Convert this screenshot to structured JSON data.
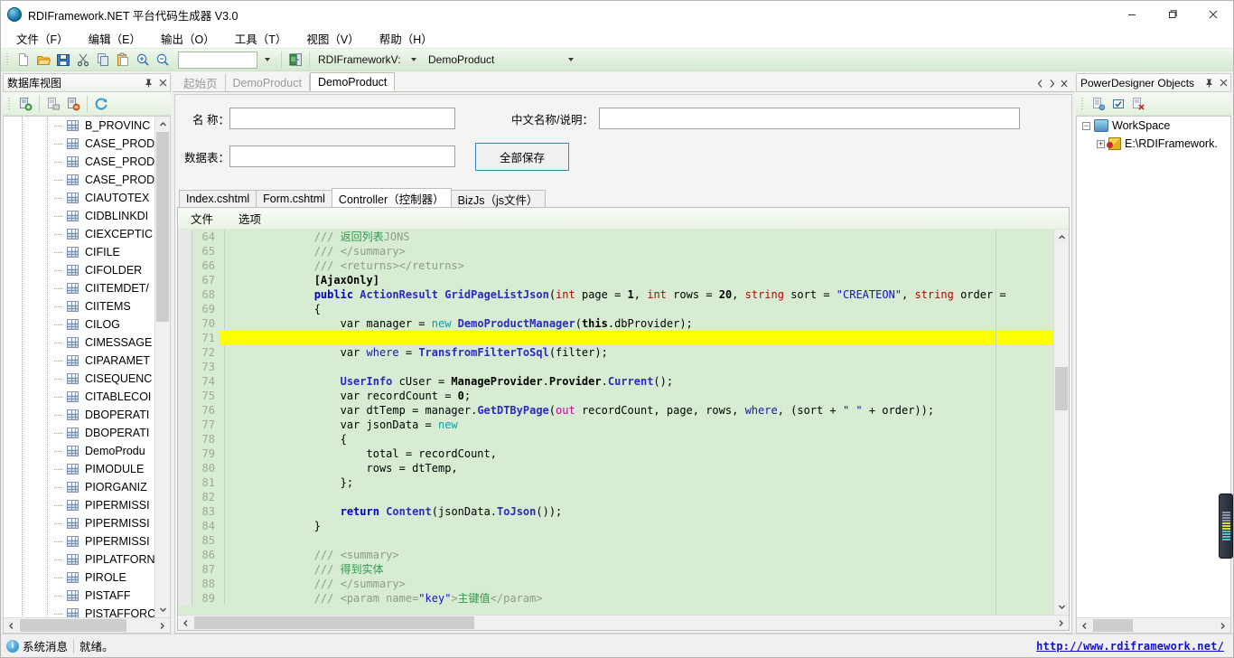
{
  "window": {
    "title": "RDIFramework.NET 平台代码生成器 V3.0",
    "icon": "app-logo-icon",
    "minimize": "minimize-icon",
    "maximize": "maximize-icon",
    "close": "close-icon"
  },
  "menubar": {
    "items": [
      {
        "label": "文件（F）"
      },
      {
        "label": "编辑（E）"
      },
      {
        "label": "输出（O）"
      },
      {
        "label": "工具（T）"
      },
      {
        "label": "视图（V）"
      },
      {
        "label": "帮助（H）"
      }
    ]
  },
  "toolbar": {
    "buttons": [
      {
        "name": "new-file-icon",
        "glyph": "doc"
      },
      {
        "name": "open-folder-icon",
        "glyph": "folder"
      },
      {
        "name": "save-icon",
        "glyph": "save"
      },
      {
        "name": "cut-icon",
        "glyph": "cut"
      },
      {
        "name": "copy-icon",
        "glyph": "copy"
      },
      {
        "name": "paste-icon",
        "glyph": "paste"
      },
      {
        "name": "zoom-in-icon",
        "glyph": "zoomin"
      },
      {
        "name": "zoom-out-icon",
        "glyph": "zoomout"
      }
    ],
    "search_value": "",
    "export_icon": "export-door-icon",
    "project_combo_value": "RDIFrameworkV:",
    "table_combo_value": "DemoProduct"
  },
  "left_panel": {
    "title": "数据库视图",
    "pin_icon": "pin-icon",
    "close_icon": "close-icon",
    "toolbar": [
      {
        "name": "add-connection-icon"
      },
      {
        "name": "edit-connection-icon"
      },
      {
        "name": "remove-connection-icon"
      },
      {
        "name": "refresh-icon"
      }
    ],
    "tree_items": [
      "B_PROVINC",
      "CASE_PROD",
      "CASE_PROD",
      "CASE_PROD",
      "CIAUTOTEX",
      "CIDBLINKDI",
      "CIEXCEPTIC",
      "CIFILE",
      "CIFOLDER",
      "CIITEMDET/",
      "CIITEMS",
      "CILOG",
      "CIMESSAGE",
      "CIPARAMET",
      "CISEQUENC",
      "CITABLECOI",
      "DBOPERATI",
      "DBOPERATI",
      "DemoProdu",
      "PIMODULE",
      "PIORGANIZ",
      "PIPERMISSI",
      "PIPERMISSI",
      "PIPERMISSI",
      "PIPLATFORN",
      "PIROLE",
      "PISTAFF",
      "PISTAFFORC"
    ]
  },
  "document_tabs": {
    "tabs": [
      {
        "label": "起始页",
        "active": false
      },
      {
        "label": "DemoProduct",
        "active": false
      },
      {
        "label": "DemoProduct",
        "active": true
      }
    ],
    "nav_prev": "prev-tab-icon",
    "nav_next": "next-tab-icon",
    "nav_close": "close-tab-icon"
  },
  "form": {
    "name_label": "名 称：",
    "name_value": "",
    "cn_name_label": "中文名称/说明：",
    "cn_name_value": "",
    "table_label": "数据表：",
    "table_value": "",
    "save_all_label": "全部保存"
  },
  "inner_tabs": [
    {
      "label": "Index.cshtml",
      "active": false
    },
    {
      "label": "Form.cshtml",
      "active": false
    },
    {
      "label": "Controller（控制器）",
      "active": true
    },
    {
      "label": "BizJs（js文件）",
      "active": false
    }
  ],
  "editor": {
    "menu": [
      "文件",
      "选项"
    ],
    "first_line_number": 64,
    "highlight_line": 71,
    "lines": [
      {
        "n": 64,
        "html": "            <span class='cmt'>///</span> <span class='cmt-cn'>返回列表</span><span class='cmt'>JONS</span>"
      },
      {
        "n": 65,
        "html": "            <span class='cmt'>/// &lt;/summary&gt;</span>"
      },
      {
        "n": 66,
        "html": "            <span class='cmt'>/// &lt;returns&gt;&lt;/returns&gt;</span>"
      },
      {
        "n": 67,
        "html": "            <span class='bld'>[AjaxOnly]</span>"
      },
      {
        "n": 68,
        "html": "            <span class='kw'>public</span> <span class='typ'>ActionResult</span> <span class='typ'>GridPageListJson</span>(<span class='kw2'>int</span> page = <span class='bld'>1</span>, <span class='kw2'>int</span> rows = <span class='bld'>20</span>, <span class='kw2'>string</span> sort = <span class='str'>\"CREATEON\"</span>, <span class='kw2'>string</span> order ="
      },
      {
        "n": 69,
        "html": "            {"
      },
      {
        "n": 70,
        "html": "                var manager = <span class='kw3'>new</span> <span class='typ'>DemoProductManager</span>(<span class='bld'>this</span>.dbProvider);"
      },
      {
        "n": 71,
        "html": ""
      },
      {
        "n": 72,
        "html": "                var <span class='var'>where</span> = <span class='typ'>TransfromFilterToSql</span>(filter);"
      },
      {
        "n": 73,
        "html": ""
      },
      {
        "n": 74,
        "html": "                <span class='typ'>UserInfo</span> cUser = <span class='bld'>ManageProvider</span>.<span class='bld'>Provider</span>.<span class='typ'>Current</span>();"
      },
      {
        "n": 75,
        "html": "                var recordCount = <span class='bld'>0</span>;"
      },
      {
        "n": 76,
        "html": "                var dtTemp = manager.<span class='typ'>GetDTByPage</span>(<span class='kw4'>out</span> recordCount, page, rows, <span class='var'>where</span>, (sort + <span class='str'>\" \"</span> + order));"
      },
      {
        "n": 77,
        "html": "                var jsonData = <span class='kw3'>new</span>"
      },
      {
        "n": 78,
        "html": "                {"
      },
      {
        "n": 79,
        "html": "                    total = recordCount,"
      },
      {
        "n": 80,
        "html": "                    rows = dtTemp,"
      },
      {
        "n": 81,
        "html": "                };"
      },
      {
        "n": 82,
        "html": ""
      },
      {
        "n": 83,
        "html": "                <span class='kw'>return</span> <span class='typ'>Content</span>(jsonData.<span class='typ'>ToJson</span>());"
      },
      {
        "n": 84,
        "html": "            }"
      },
      {
        "n": 85,
        "html": ""
      },
      {
        "n": 86,
        "html": "            <span class='cmt'>/// &lt;summary&gt;</span>"
      },
      {
        "n": 87,
        "html": "            <span class='cmt'>///</span> <span class='cmt-cn'>得到实体</span>"
      },
      {
        "n": 88,
        "html": "            <span class='cmt'>/// &lt;/summary&gt;</span>"
      },
      {
        "n": 89,
        "html": "            <span class='cmt'>/// &lt;param name=</span><span class='str'>\"key\"</span><span class='cmt'>&gt;</span><span class='cmt-cn'>主键值</span><span class='cmt'>&lt;/param&gt;</span>"
      }
    ]
  },
  "right_panel": {
    "title": "PowerDesigner Objects",
    "pin_icon": "pin-icon",
    "close_icon": "close-icon",
    "toolbar": [
      {
        "name": "model-list-icon"
      },
      {
        "name": "select-check-icon"
      },
      {
        "name": "delete-model-icon"
      }
    ],
    "tree": {
      "root_label": "WorkSpace",
      "child_label": "E:\\RDIFramework."
    }
  },
  "statusbar": {
    "info_icon": "info-icon",
    "label": "系统消息",
    "message": "就绪。",
    "link": "http://www.rdiframework.net/"
  },
  "colors": {
    "toolbar_green": "#e2f0dd",
    "editor_bg": "#d7ecd2",
    "highlight": "#ffff00",
    "accent_blue": "#3c7fb1",
    "link_blue": "#1111cc"
  }
}
